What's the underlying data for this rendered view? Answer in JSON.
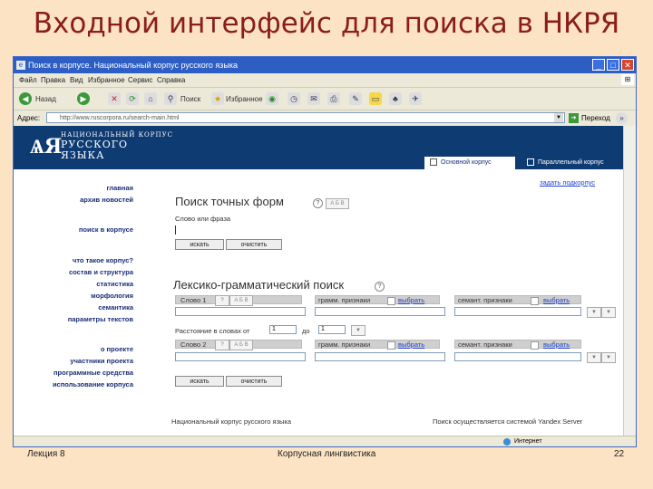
{
  "slide": {
    "title": "Входной интерфейс для поиска в НКРЯ",
    "footer_left": "Лекция 8",
    "footer_center": "Корпусная лингвистика",
    "footer_right": "22"
  },
  "window": {
    "title": "Поиск в корпусе. Национальный корпус русского языка",
    "minimize": "_",
    "maximize": "□",
    "close": "✕"
  },
  "menubar": [
    "Файл",
    "Правка",
    "Вид",
    "Избранное",
    "Сервис",
    "Справка"
  ],
  "toolbar": {
    "back_label": "Назад",
    "search_label": "Поиск",
    "favorites_label": "Избранное"
  },
  "address": {
    "label": "Адрес:",
    "url": "http://www.ruscorpora.ru/search-main.html",
    "go_label": "Переход"
  },
  "site": {
    "logo_line1": "НАЦИОНАЛЬНЫЙ КОРПУС",
    "logo_line2": "РУССКОГО",
    "logo_line3": "ЯЗЫКА",
    "tab_main": "Основной корпус",
    "tab_parallel": "Параллельный корпус",
    "subcorpus_link": "задать подкорпус"
  },
  "nav": {
    "group1": [
      "главная",
      "архив новостей"
    ],
    "group2": [
      "поиск в корпусе"
    ],
    "group3": [
      "что такое корпус?",
      "состав и структура",
      "статистика",
      "морфология",
      "семантика",
      "параметры текстов"
    ],
    "group4": [
      "о проекте",
      "участники проекта",
      "программные средства",
      "использование корпуса"
    ]
  },
  "exact": {
    "heading": "Поиск точных форм",
    "help": "?",
    "keyboard": "А Б В",
    "field_label": "Слово или фраза",
    "search_button": "искать",
    "clear_button": "очистить"
  },
  "lexgram": {
    "heading": "Лексико-грамматический поиск",
    "help": "?",
    "word1_label": "Слово 1",
    "word2_label": "Слово 2",
    "gram_label": "грамм. признаки",
    "sem_label": "семант. признаки",
    "choose_link": "выбрать",
    "distance_label": "Расстояние в словах от",
    "distance_from": "1",
    "distance_to_label": "до",
    "distance_to": "1",
    "search_button": "искать",
    "clear_button": "очистить"
  },
  "page_footer": {
    "left": "Национальный корпус русского языка",
    "right": "Поиск осуществляется системой Yandex Server"
  },
  "status": {
    "zone": "Интернет"
  }
}
